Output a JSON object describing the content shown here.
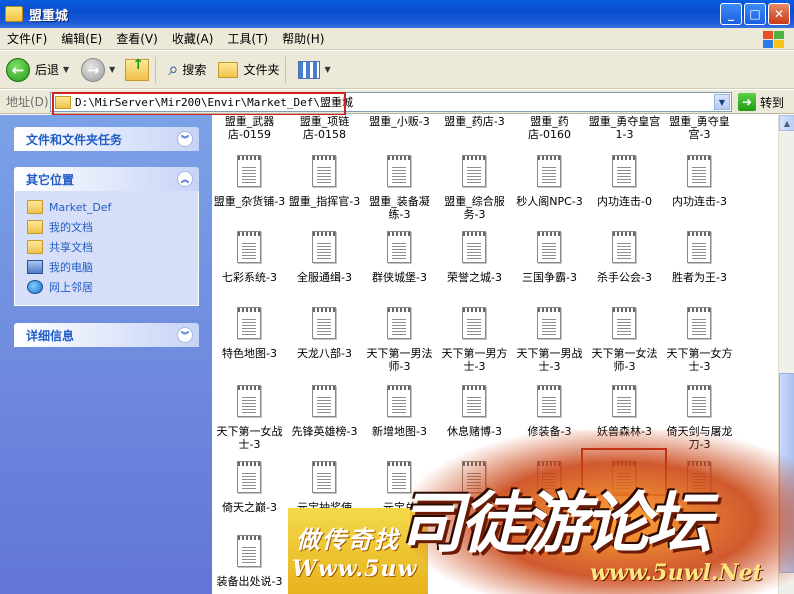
{
  "window": {
    "title": "盟重城"
  },
  "menu": [
    "文件(F)",
    "编辑(E)",
    "查看(V)",
    "收藏(A)",
    "工具(T)",
    "帮助(H)"
  ],
  "toolbar": {
    "back": "后退",
    "search": "搜索",
    "folders": "文件夹"
  },
  "address": {
    "label": "地址(D)",
    "path": "D:\\MirServer\\Mir200\\Envir\\Market_Def\\盟重城",
    "go": "转到"
  },
  "sidebar": {
    "tasks_title": "文件和文件夹任务",
    "places_title": "其它位置",
    "places": [
      "Market_Def",
      "我的文档",
      "共享文档",
      "我的电脑",
      "网上邻居"
    ],
    "details_title": "详细信息"
  },
  "files": [
    "盟重_武器店-0159",
    "盟重_项链店-0158",
    "盟重_小贩-3",
    "盟重_药店-3",
    "盟重_药店-0160",
    "盟重_勇夺皇宫1-3",
    "盟重_勇夺皇宫-3",
    "盟重_杂货铺-3",
    "盟重_指挥官-3",
    "盟重_装备凝练-3",
    "盟重_综合服务-3",
    "秒人阁NPC-3",
    "内功连击-0",
    "内功连击-3",
    "七彩系统-3",
    "全服通缉-3",
    "群侠城堡-3",
    "荣誉之城-3",
    "三国争霸-3",
    "杀手公会-3",
    "胜者为王-3",
    "特色地图-3",
    "天龙八部-3",
    "天下第一男法师-3",
    "天下第一男方士-3",
    "天下第一男战士-3",
    "天下第一女法师-3",
    "天下第一女方士-3",
    "天下第一女战士-3",
    "先锋英雄榜-3",
    "新增地图-3",
    "休息赌博-3",
    "修装备-3",
    "妖兽森林-3",
    "倚天剑与屠龙刀-3",
    "倚天之巅-3",
    "元宝抽奖使者-3",
    "元宝兑",
    "",
    "",
    "",
    "",
    "装备出处说-3"
  ],
  "watermark": {
    "slogan": "做传奇找",
    "url": "Www.5uw",
    "brand": "司徒游论坛",
    "url2": "www.5uwl.Net"
  }
}
